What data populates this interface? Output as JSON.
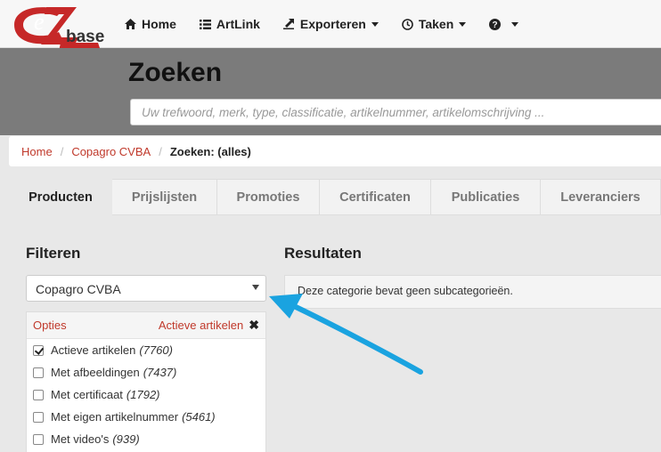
{
  "logo": {
    "letter": "e",
    "text": "base"
  },
  "nav": {
    "items": [
      {
        "label": "Home",
        "icon": "home-icon"
      },
      {
        "label": "ArtLink",
        "icon": "list-icon"
      },
      {
        "label": "Exporteren",
        "icon": "export-icon",
        "dropdown": true
      },
      {
        "label": "Taken",
        "icon": "clock-icon",
        "dropdown": true
      },
      {
        "label": "",
        "icon": "help-icon",
        "dropdown": true
      }
    ]
  },
  "hero": {
    "title": "Zoeken",
    "search_placeholder": "Uw trefwoord, merk, type, classificatie, artikelnummer, artikelomschrijving ..."
  },
  "breadcrumb": {
    "items": [
      "Home",
      "Copagro CVBA"
    ],
    "current": "Zoeken: (alles)"
  },
  "tabs": [
    {
      "label": "Producten",
      "active": true
    },
    {
      "label": "Prijslijsten"
    },
    {
      "label": "Promoties"
    },
    {
      "label": "Certificaten"
    },
    {
      "label": "Publicaties"
    },
    {
      "label": "Leveranciers"
    }
  ],
  "filter": {
    "title": "Filteren",
    "selected_supplier": "Copagro CVBA",
    "options_label": "Opties",
    "active_label": "Actieve artikelen",
    "options": [
      {
        "label": "Actieve artikelen",
        "count": "(7760)",
        "checked": true
      },
      {
        "label": "Met afbeeldingen",
        "count": "(7437)",
        "checked": false
      },
      {
        "label": "Met certificaat",
        "count": "(1792)",
        "checked": false
      },
      {
        "label": "Met eigen artikelnummer",
        "count": "(5461)",
        "checked": false
      },
      {
        "label": "Met video's",
        "count": "(939)",
        "checked": false
      }
    ]
  },
  "results": {
    "title": "Resultaten",
    "message": "Deze categorie bevat geen subcategorieën."
  },
  "colors": {
    "accent": "#c0392b",
    "annotation_arrow": "#1aa3e0",
    "hero_bg": "#7b7b7b"
  }
}
